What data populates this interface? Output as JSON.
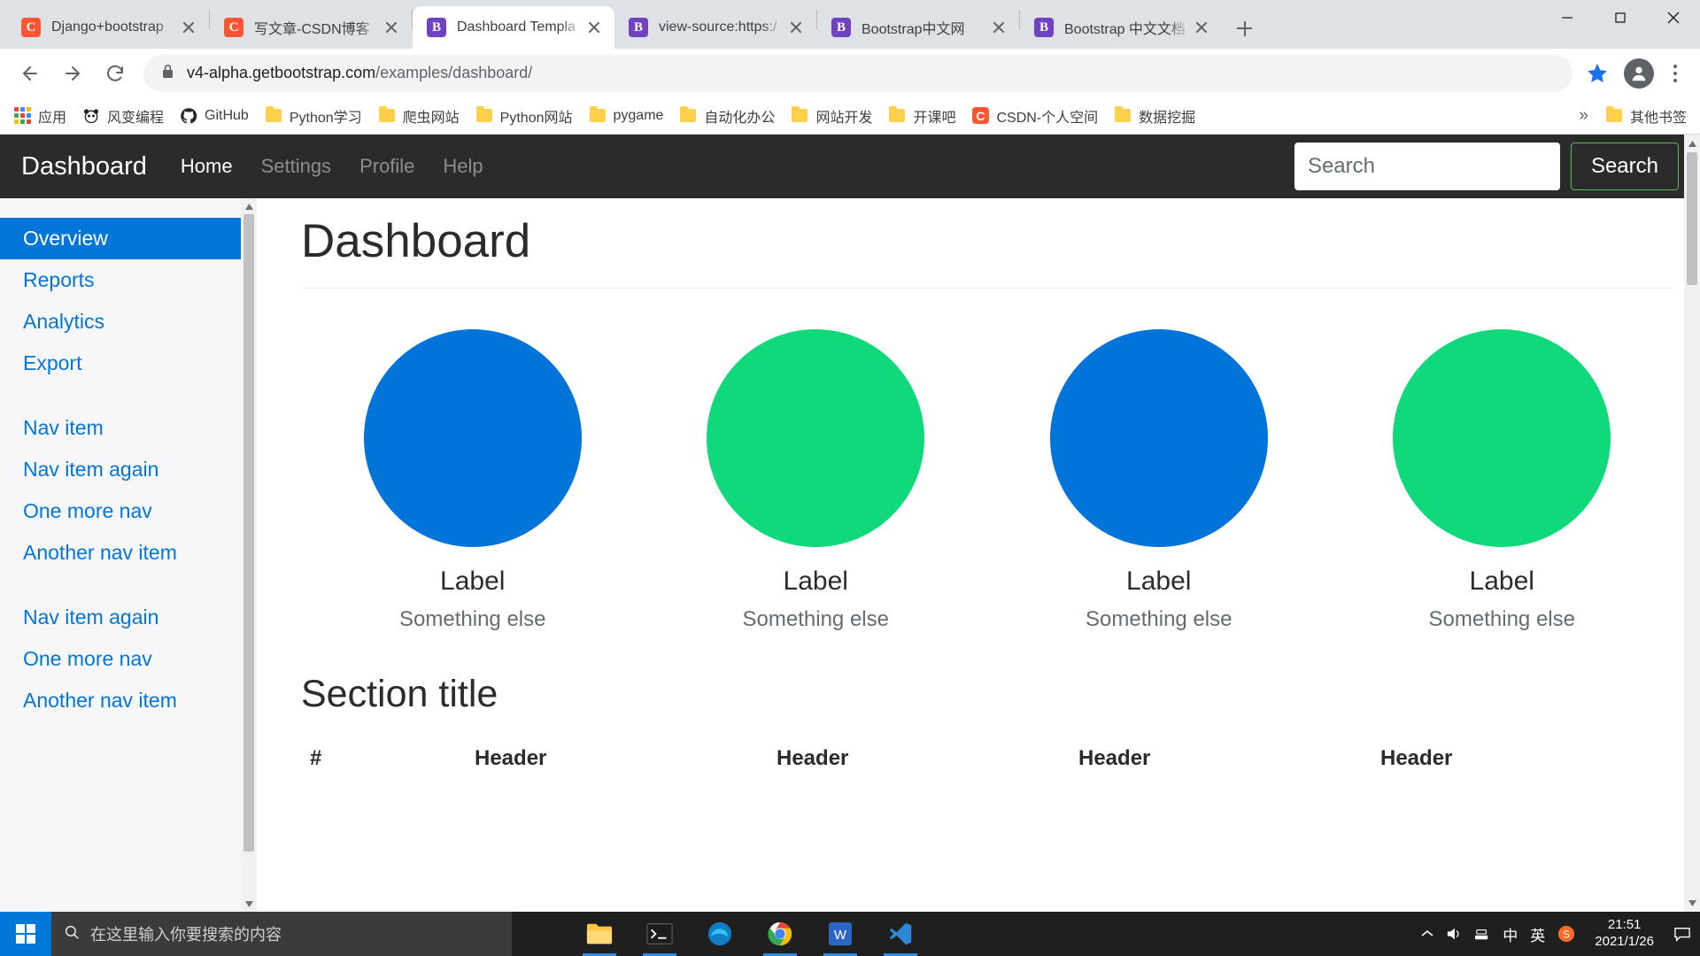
{
  "browser": {
    "tabs": [
      {
        "title": "Django+bootstrap",
        "favicon": "csdn-icon",
        "active": false
      },
      {
        "title": "写文章-CSDN博客",
        "favicon": "csdn-icon",
        "active": false
      },
      {
        "title": "Dashboard Templa",
        "favicon": "bootstrap-icon",
        "active": true
      },
      {
        "title": "view-source:https:/",
        "favicon": "bootstrap-icon",
        "active": false
      },
      {
        "title": "Bootstrap中文网",
        "favicon": "bootstrap-icon",
        "active": false
      },
      {
        "title": "Bootstrap 中文文档",
        "favicon": "bootstrap-icon",
        "active": false
      }
    ],
    "new_tab_label": "+",
    "window_controls": {
      "minimize": "minimize-icon",
      "maximize": "maximize-icon",
      "close": "close-icon"
    },
    "omnibox": {
      "back": "back-arrow-icon",
      "forward": "forward-arrow-icon",
      "reload": "reload-icon",
      "lock": "lock-icon",
      "url_host": "v4-alpha.getbootstrap.com",
      "url_path": "/examples/dashboard/",
      "star": "bookmark-star-icon",
      "profile": "profile-avatar-icon",
      "menu": "three-dots-menu-icon"
    },
    "bookmarks": [
      {
        "label": "应用",
        "icon": "apps-grid-icon"
      },
      {
        "label": "风变编程",
        "icon": "panda-icon"
      },
      {
        "label": "GitHub",
        "icon": "github-icon"
      },
      {
        "label": "Python学习",
        "icon": "folder-icon"
      },
      {
        "label": "爬虫网站",
        "icon": "folder-icon"
      },
      {
        "label": "Python网站",
        "icon": "folder-icon"
      },
      {
        "label": "pygame",
        "icon": "folder-icon"
      },
      {
        "label": "自动化办公",
        "icon": "folder-icon"
      },
      {
        "label": "网站开发",
        "icon": "folder-icon"
      },
      {
        "label": "开课吧",
        "icon": "folder-icon"
      },
      {
        "label": "CSDN-个人空间",
        "icon": "csdn-icon"
      },
      {
        "label": "数据挖掘",
        "icon": "folder-icon"
      }
    ],
    "bookmarks_overflow": "»",
    "other_bookmarks": {
      "label": "其他书签",
      "icon": "folder-icon"
    }
  },
  "navbar": {
    "brand": "Dashboard",
    "links": [
      {
        "label": "Home",
        "active": true
      },
      {
        "label": "Settings",
        "active": false
      },
      {
        "label": "Profile",
        "active": false
      },
      {
        "label": "Help",
        "active": false
      }
    ],
    "search_placeholder": "Search",
    "search_value": "",
    "search_button": "Search",
    "bg_color": "#2b2b2b",
    "search_button_border": "#5cb85c"
  },
  "sidebar": {
    "group1": [
      {
        "label": "Overview",
        "active": true
      },
      {
        "label": "Reports",
        "active": false
      },
      {
        "label": "Analytics",
        "active": false
      },
      {
        "label": "Export",
        "active": false
      }
    ],
    "group2": [
      {
        "label": "Nav item",
        "active": false
      },
      {
        "label": "Nav item again",
        "active": false
      },
      {
        "label": "One more nav",
        "active": false
      },
      {
        "label": "Another nav item",
        "active": false
      }
    ],
    "group3": [
      {
        "label": "Nav item again",
        "active": false
      },
      {
        "label": "One more nav",
        "active": false
      },
      {
        "label": "Another nav item",
        "active": false
      }
    ],
    "link_color": "#0275d8",
    "active_bg": "#0275d8"
  },
  "main": {
    "page_title": "Dashboard",
    "placeholders": [
      {
        "label": "Label",
        "sub": "Something else",
        "color": "#0074d9"
      },
      {
        "label": "Label",
        "sub": "Something else",
        "color": "#0fd97a"
      },
      {
        "label": "Label",
        "sub": "Something else",
        "color": "#0074d9"
      },
      {
        "label": "Label",
        "sub": "Something else",
        "color": "#0fd97a"
      }
    ],
    "section_title": "Section title",
    "table_headers": [
      "#",
      "Header",
      "Header",
      "Header",
      "Header"
    ]
  },
  "taskbar": {
    "start": "windows-start-icon",
    "search_placeholder": "在这里输入你要搜索的内容",
    "search_icon": "search-icon",
    "apps": [
      {
        "name": "file-explorer-icon",
        "running": true
      },
      {
        "name": "terminal-icon",
        "running": true
      },
      {
        "name": "edge-icon",
        "running": false
      },
      {
        "name": "chrome-icon",
        "running": true
      },
      {
        "name": "wps-writer-icon",
        "running": true
      },
      {
        "name": "vscode-icon",
        "running": true
      }
    ],
    "tray": {
      "chevron": "show-hidden-icons-icon",
      "volume": "volume-icon",
      "network": "network-icon",
      "ime_mode": "中",
      "ime_lang": "英",
      "sogou": "sogou-icon",
      "time": "21:51",
      "date": "2021/1/26",
      "action_center": "notification-icon"
    }
  }
}
